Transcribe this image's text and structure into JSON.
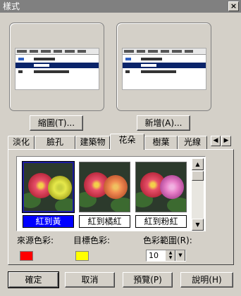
{
  "window": {
    "title": "樣式",
    "close_glyph": "×"
  },
  "previews": {
    "left_button": "縮圖(T)...",
    "right_button": "新增(A)..."
  },
  "tabs": [
    {
      "label": "淡化"
    },
    {
      "label": "臉孔"
    },
    {
      "label": "建築物"
    },
    {
      "label": "花朵"
    },
    {
      "label": "樹葉"
    },
    {
      "label": "光線"
    }
  ],
  "active_tab": "花朵",
  "tab_scroll": {
    "left": "◀",
    "right": "▶"
  },
  "gallery": {
    "items": [
      {
        "caption": "紅到黃",
        "selected": true,
        "colors": [
          "#e8506a",
          "#e6e84a"
        ]
      },
      {
        "caption": "紅到橘紅",
        "selected": false,
        "colors": [
          "#e8506a",
          "#f08a50"
        ]
      },
      {
        "caption": "紅到粉紅",
        "selected": false,
        "colors": [
          "#e8506a",
          "#e880c8"
        ]
      }
    ],
    "scroll_up": "▲",
    "scroll_down": "▼"
  },
  "source_color": {
    "label": "來源色彩:",
    "color": "#ff0000"
  },
  "target_color": {
    "label": "目標色彩:",
    "color": "#ffff00"
  },
  "color_range": {
    "label": "色彩範圍(R):",
    "value": "10",
    "up": "▲",
    "down": "▼",
    "drop": "▼"
  },
  "buttons": {
    "ok": "確定",
    "cancel": "取消",
    "preview": "預覽(P)",
    "help": "說明(H)"
  }
}
